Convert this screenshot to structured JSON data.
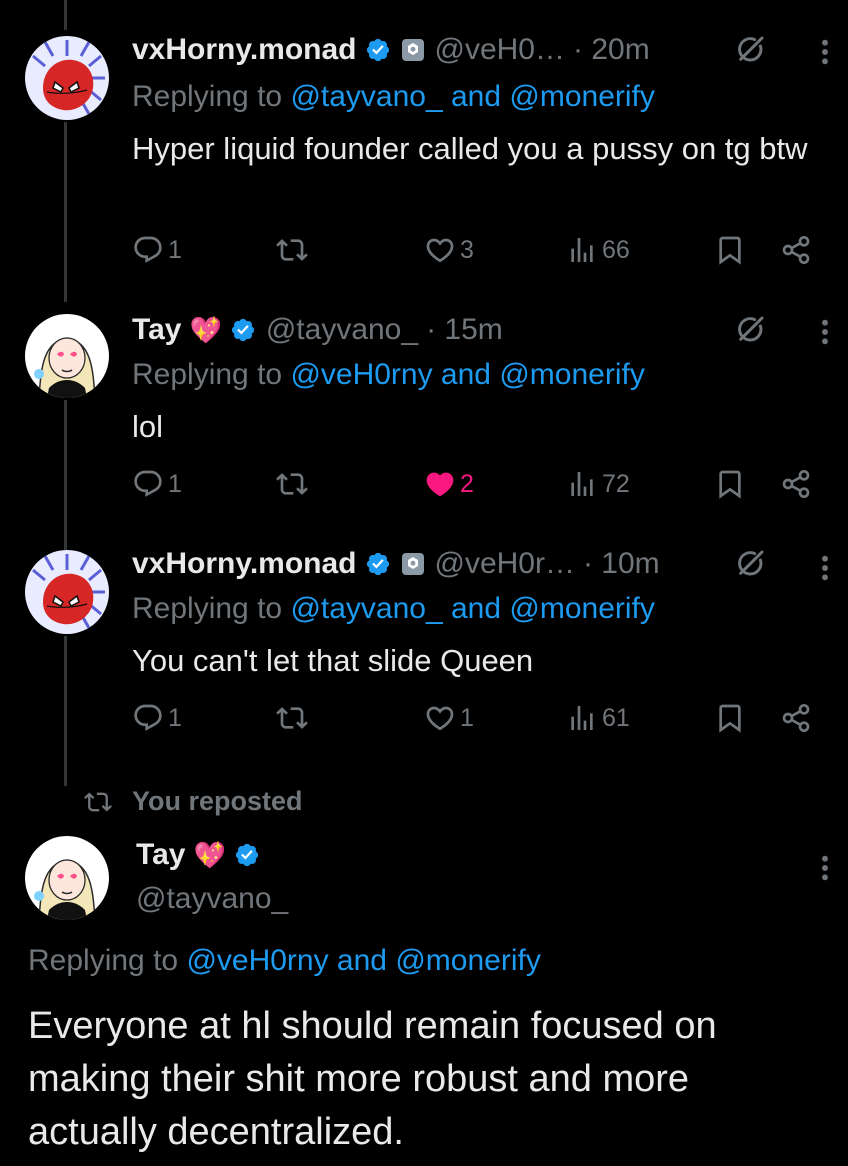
{
  "tweets": [
    {
      "name": "vxHorny.monad",
      "handle": "@veH0…",
      "time": "· 20m",
      "replying_prefix": "Replying to ",
      "reply_mention_1": "@tayvano_",
      "reply_and": " and ",
      "reply_mention_2": "@monerify",
      "text": "Hyper liquid founder called you a pussy on tg btw",
      "replies": "1",
      "likes": "3",
      "views": "66"
    },
    {
      "name": "Tay",
      "emoji": "💖",
      "handle": "@tayvano_",
      "time": "· 15m",
      "replying_prefix": "Replying to ",
      "reply_mention_1": "@veH0rny and",
      "reply_and": " ",
      "reply_mention_2": "@monerify",
      "text": "lol",
      "replies": "1",
      "likes": "2",
      "views": "72"
    },
    {
      "name": "vxHorny.monad",
      "handle": "@veH0r…",
      "time": "· 10m",
      "replying_prefix": "Replying to ",
      "reply_mention_1": "@tayvano_",
      "reply_and": " and ",
      "reply_mention_2": "@monerify",
      "text": "You can't let that slide Queen",
      "replies": "1",
      "likes": "1",
      "views": "61"
    }
  ],
  "repost_note": "You reposted",
  "main_tweet": {
    "name": "Tay",
    "emoji": "💖",
    "handle": "@tayvano_",
    "replying_prefix": "Replying to ",
    "reply_mention_1": "@veH0rny and",
    "reply_and": " ",
    "reply_mention_2": "@monerify",
    "text": "Everyone at hl should remain focused on making their shit more robust and more actually decentralized."
  },
  "colors": {
    "accent": "#1d9bf0",
    "like": "#f91880",
    "muted": "#71767b",
    "background": "#000000"
  },
  "icons": [
    "reply-icon",
    "repost-icon",
    "like-icon",
    "views-icon",
    "bookmark-icon",
    "share-icon",
    "grok-icon",
    "more-icon",
    "verified-icon"
  ]
}
